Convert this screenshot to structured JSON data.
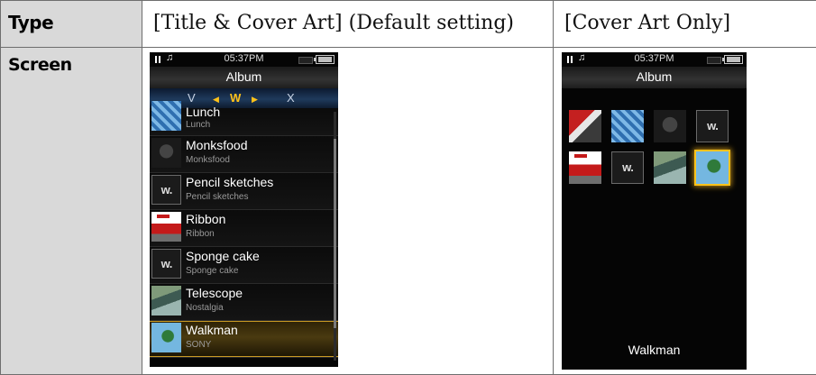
{
  "table": {
    "header": {
      "type_label": "Type",
      "col1_title": "[Title & Cover Art] (Default setting)",
      "col2_title": "[Cover Art Only]"
    },
    "row_label": "Screen"
  },
  "screen1": {
    "status": {
      "time": "05:37PM",
      "icons": [
        "pause-icon",
        "music-note-icon",
        "signal-icon",
        "battery-icon"
      ]
    },
    "title": "Album",
    "index": {
      "prev": "V",
      "current": "W",
      "next": "X"
    },
    "items": [
      {
        "title": "Lunch",
        "subtitle": "Lunch",
        "thumb": "blue-tiles"
      },
      {
        "title": "Monksfood",
        "subtitle": "Monksfood",
        "thumb": "figure"
      },
      {
        "title": "Pencil sketches",
        "subtitle": "Pencil sketches",
        "thumb": "walkman-logo"
      },
      {
        "title": "Ribbon",
        "subtitle": "Ribbon",
        "thumb": "ribbon-car"
      },
      {
        "title": "Sponge cake",
        "subtitle": "Sponge cake",
        "thumb": "walkman-logo"
      },
      {
        "title": "Telescope",
        "subtitle": "Nostalgia",
        "thumb": "landscape"
      },
      {
        "title": "Walkman",
        "subtitle": "SONY",
        "thumb": "globe",
        "selected": true
      }
    ],
    "colors": {
      "accent": "#ffc21a",
      "index_bar": "#1f3a5c"
    }
  },
  "screen2": {
    "status": {
      "time": "05:37PM"
    },
    "title": "Album",
    "caption": "Walkman",
    "grid_rows": 2,
    "grid_cols": 4,
    "selected_index": 7
  }
}
